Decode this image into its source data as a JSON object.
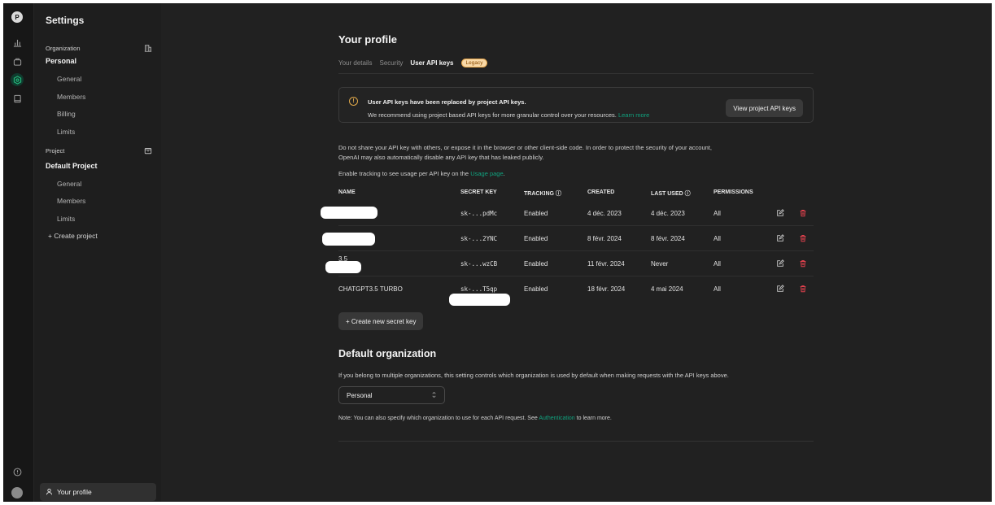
{
  "rail": {
    "avatar_letter": "P",
    "icons": [
      "dashboard-icon",
      "playground-icon",
      "settings-icon",
      "docs-icon"
    ],
    "help_icon": "help-icon",
    "user_avatar": "user-avatar"
  },
  "sidebar": {
    "title": "Settings",
    "organization_heading": "Organization",
    "organization_name": "Personal",
    "organization_items": [
      "General",
      "Members",
      "Billing",
      "Limits"
    ],
    "project_heading": "Project",
    "project_name": "Default Project",
    "project_items": [
      "General",
      "Members",
      "Limits"
    ],
    "create_project": "+ Create project",
    "profile_label": "Your profile"
  },
  "profile": {
    "title": "Your profile",
    "tabs": [
      "Your details",
      "Security",
      "User API keys"
    ],
    "legacy_badge": "Legacy"
  },
  "notice": {
    "title": "User API keys have been replaced by project API keys.",
    "body": "We recommend using project based API keys for more granular control over your resources.",
    "link": "Learn more",
    "button": "View project API keys"
  },
  "warning_text_1": "Do not share your API key with others, or expose it in the browser or other client-side code. In order to protect the security of your account,",
  "warning_text_2": "OpenAI may also automatically disable any API key that has leaked publicly.",
  "tracking_text": "Enable tracking to see usage per API key on the",
  "tracking_link": "Usage page",
  "tracking_end": ".",
  "table": {
    "headers": [
      "NAME",
      "SECRET KEY",
      "TRACKING",
      "CREATED",
      "LAST USED",
      "PERMISSIONS"
    ],
    "rows": [
      {
        "name": "",
        "secret": "sk-...pdMc",
        "tracking": "Enabled",
        "created": "4 déc. 2023",
        "last_used": "4 déc. 2023",
        "permissions": "All"
      },
      {
        "name": "",
        "secret": "sk-...2YNC",
        "tracking": "Enabled",
        "created": "8 févr. 2024",
        "last_used": "8 févr. 2024",
        "permissions": "All"
      },
      {
        "name": "3.5",
        "secret": "sk-...wzCB",
        "tracking": "Enabled",
        "created": "11 févr. 2024",
        "last_used": "Never",
        "permissions": "All"
      },
      {
        "name": "CHATGPT3.5 TURBO",
        "secret": "sk-...T5qp",
        "tracking": "Enabled",
        "created": "18 févr. 2024",
        "last_used": "4 mai 2024",
        "permissions": "All"
      }
    ]
  },
  "create_key_button": "+ Create new secret key",
  "default_org": {
    "title": "Default organization",
    "description": "If you belong to multiple organizations, this setting controls which organization is used by default when making requests with the API keys above.",
    "selected": "Personal",
    "note_start": "Note: You can also specify which organization to use for each API request. See",
    "note_link": "Authentication",
    "note_end": "to learn more."
  },
  "colors": {
    "accent": "#10a37f",
    "danger": "#e0414d",
    "warning": "#e0a84a",
    "background": "#212121",
    "sidebar": "#1e1e1e"
  }
}
